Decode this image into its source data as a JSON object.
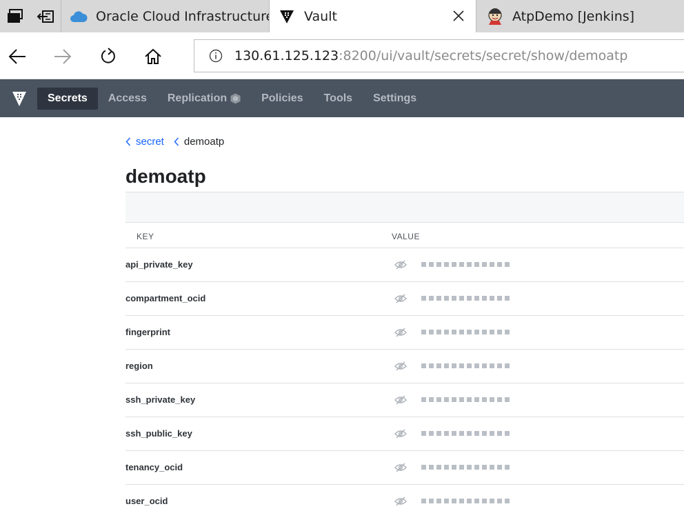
{
  "browser": {
    "tabs": [
      {
        "title": "Oracle Cloud Infrastructure",
        "icon": "cloud-icon",
        "active": false
      },
      {
        "title": "Vault",
        "icon": "vault-favicon",
        "active": true
      },
      {
        "title": "AtpDemo [Jenkins]",
        "icon": "jenkins-icon",
        "active": false
      }
    ],
    "url": {
      "host": "130.61.125.123",
      "rest": ":8200/ui/vault/secrets/secret/show/demoatp"
    }
  },
  "vault_nav": {
    "items": [
      {
        "label": "Secrets",
        "active": true
      },
      {
        "label": "Access",
        "active": false
      },
      {
        "label": "Replication",
        "active": false
      },
      {
        "label": "Policies",
        "active": false
      },
      {
        "label": "Tools",
        "active": false
      },
      {
        "label": "Settings",
        "active": false
      }
    ]
  },
  "breadcrumb": {
    "parent": "secret",
    "current": "demoatp"
  },
  "page": {
    "title": "demoatp"
  },
  "table": {
    "headers": {
      "key": "KEY",
      "value": "VALUE"
    },
    "rows": [
      {
        "key": "api_private_key"
      },
      {
        "key": "compartment_ocid"
      },
      {
        "key": "fingerprint"
      },
      {
        "key": "region"
      },
      {
        "key": "ssh_private_key"
      },
      {
        "key": "ssh_public_key"
      },
      {
        "key": "tenancy_ocid"
      },
      {
        "key": "user_ocid"
      }
    ]
  },
  "colors": {
    "vault_nav_bg": "#4a5360",
    "link": "#1563ff",
    "masked_dot": "#babfc6"
  }
}
